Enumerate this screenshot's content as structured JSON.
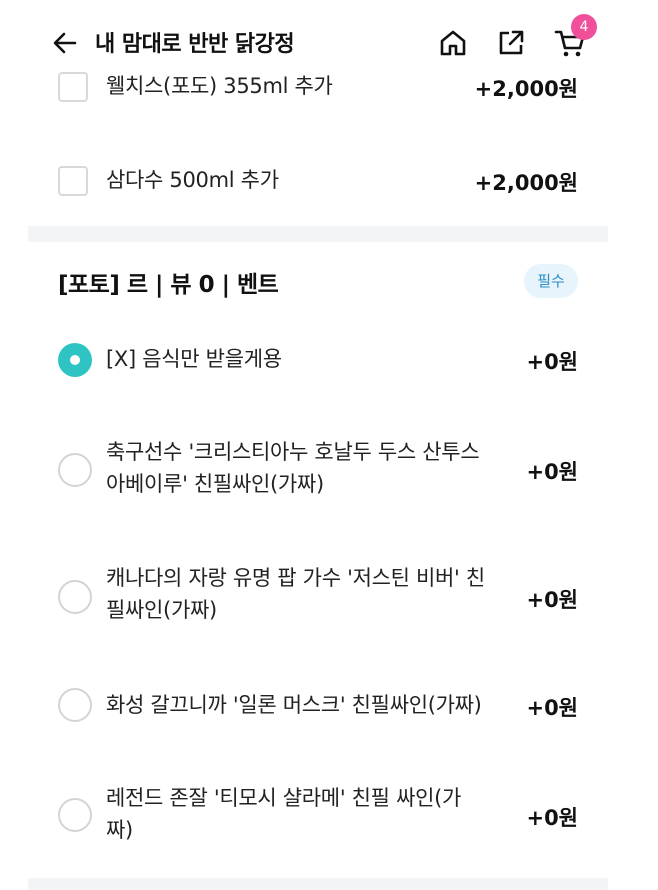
{
  "header": {
    "title": "내 맘대로 반반 닭강정",
    "back_icon": "arrow-left-icon",
    "home_icon": "home-icon",
    "share_icon": "share-icon",
    "cart_icon": "cart-icon",
    "cart_count": "4",
    "badge_color": "#f0509a"
  },
  "addons": [
    {
      "label": "웰치스(포도) 355ml 추가",
      "price": "+2,000원",
      "checked": false
    },
    {
      "label": "삼다수 500ml 추가",
      "price": "+2,000원",
      "checked": false
    }
  ],
  "section": {
    "title": "[포토] 르 | 뷰 0 |  벤트",
    "required_label": "필수",
    "accent_color": "#2ec4c4",
    "options": [
      {
        "line1": "[X] 음식만 받을게용",
        "line2": "",
        "price": "+0원",
        "selected": true
      },
      {
        "line1": "축구선수 '크리스티아누 호날두 두스 산투스",
        "line2": "아베이루' 친필싸인(가짜)",
        "price": "+0원",
        "selected": false
      },
      {
        "line1": "캐나다의 자랑 유명 팝 가수 '저스틴 비버' 친",
        "line2": "필싸인(가짜)",
        "price": "+0원",
        "selected": false
      },
      {
        "line1": "화성 갈끄니까 '일론 머스크' 친필싸인(가짜)",
        "line2": "",
        "price": "+0원",
        "selected": false
      },
      {
        "line1": "레전드 존잘 '티모시 샬라메' 친필 싸인(가",
        "line2": "짜)",
        "price": "+0원",
        "selected": false
      }
    ]
  }
}
